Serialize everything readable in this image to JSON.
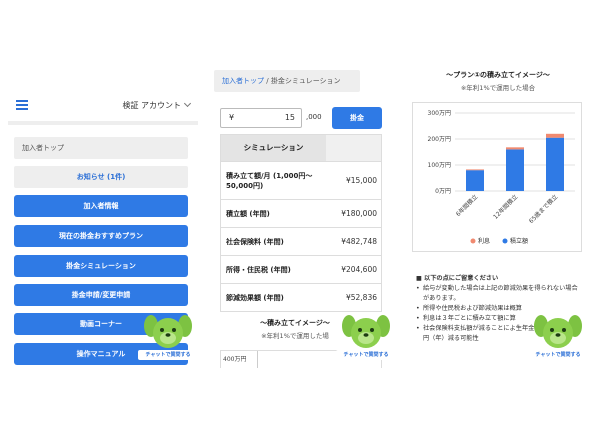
{
  "panel1": {
    "account_label": "検証 アカウント",
    "breadcrumb": "加入者トップ",
    "notice_button": "お知らせ (1件)",
    "menu_items": [
      "加入者情報",
      "現在の掛金おすすめプラン",
      "掛金シミュレーション",
      "掛金申請/変更申請",
      "動画コーナー",
      "操作マニュアル"
    ]
  },
  "mascot": {
    "badge": "チャットで質問する",
    "color": "#7dc242"
  },
  "panel2": {
    "breadcrumb": {
      "home": "加入者トップ",
      "sep": "/",
      "current": "掛金シミュレーション"
    },
    "input": {
      "prefix": "¥",
      "value": "15",
      "suffix": ",000"
    },
    "calc_button": "掛金",
    "table_header": "シミュレーション",
    "rows": [
      {
        "label": "積み立て額/月 (1,000円〜50,000円)",
        "value": "¥15,000"
      },
      {
        "label": "積立額 (年間)",
        "value": "¥180,000"
      },
      {
        "label": "社会保険料 (年間)",
        "value": "¥482,748"
      },
      {
        "label": "所得・住民税 (年間)",
        "value": "¥204,600"
      },
      {
        "label": "節減効果額 (年間)",
        "value": "¥52,836"
      }
    ],
    "chart_title": "〜積み立てイメージ〜",
    "chart_subtitle": "※年利1%で運用した場",
    "mini_axis_label": "400万円"
  },
  "panel3": {
    "title": "〜プラン①の積み立てイメージ〜",
    "subtitle": "※年利1%で運用した場合",
    "notes_heading": "■ 以下の点にご留意ください",
    "notes": [
      "給与が変動した場合は上記の節減効果を得られない場合があります。",
      "所得や住民税および節減効果は概算",
      "利息は３年ごとに積み立て額に算",
      "社会保険料支払額が減ることによ生年金受給額が 1,315 円（年）減る可能性"
    ]
  },
  "chart_data": {
    "type": "bar",
    "title": "〜プラン①の積み立てイメージ〜",
    "categories": [
      "6年間積立",
      "12年間積立",
      "65歳まで積立"
    ],
    "series": [
      {
        "name": "積立額",
        "values": [
          80,
          160,
          205
        ],
        "color": "#2f7ae5"
      },
      {
        "name": "利息",
        "values": [
          3,
          8,
          15
        ],
        "color": "#f08a70"
      }
    ],
    "stacked": true,
    "y_ticks": [
      "0万円",
      "100万円",
      "200万円",
      "300万円"
    ],
    "ylim": [
      0,
      300
    ],
    "grid": true,
    "legend": "bottom"
  }
}
